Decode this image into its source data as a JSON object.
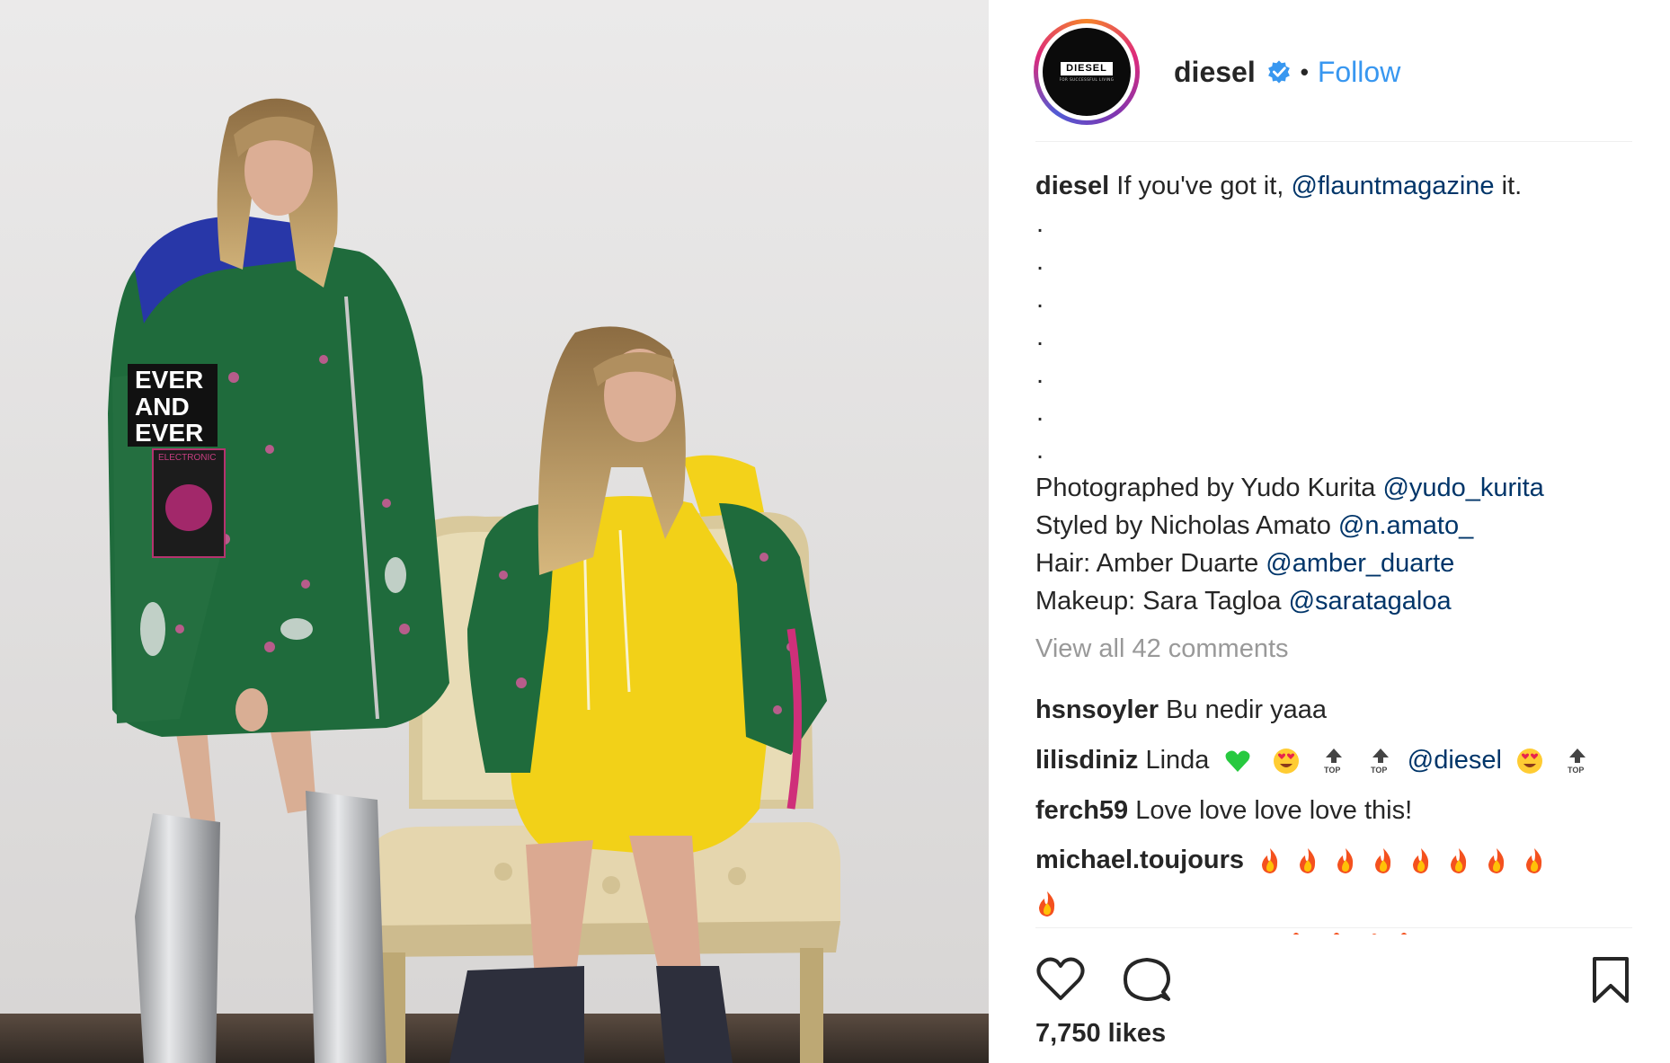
{
  "post": {
    "image_description_icon": "photo-placeholder",
    "account": {
      "username": "diesel",
      "avatar_logo": "DIESEL",
      "avatar_tagline": "FOR SUCCESSFUL LIVING",
      "verified": true,
      "separator": "•",
      "follow_label": "Follow"
    },
    "caption": {
      "author": "diesel",
      "text_before": "If you've got it,",
      "mention": "@flauntmagazine",
      "text_after": "it.",
      "dots": [
        ".",
        ".",
        ".",
        ".",
        ".",
        ".",
        "."
      ],
      "credits": [
        {
          "label": "Photographed by Yudo Kurita",
          "mention": "@yudo_kurita"
        },
        {
          "label": "Styled by Nicholas Amato",
          "mention": "@n.amato_"
        },
        {
          "label": "Hair: Amber Duarte",
          "mention": "@amber_duarte"
        },
        {
          "label": "Makeup: Sara Tagloa",
          "mention": "@saratagaloa"
        }
      ]
    },
    "view_all_comments": "View all 42 comments",
    "comments": [
      {
        "user": "hsnsoyler",
        "text": "Bu nedir yaaa"
      },
      {
        "user": "lilisdiniz",
        "text": "Linda",
        "mention": "@diesel"
      },
      {
        "user": "ferch59",
        "text": "Love love love love this!"
      },
      {
        "user": "michael.toujours",
        "text": ""
      }
    ],
    "emoji_top_label": "TOP",
    "photo_patch": {
      "line1": "EVER",
      "line2": "AND",
      "line3": "EVER",
      "sub": "ELECTRONIC"
    },
    "likes": "7,750 likes",
    "colors": {
      "follow": "#3897f0",
      "mention": "#003569",
      "muted": "#999999",
      "text": "#262626",
      "verified": "#3897f0"
    }
  }
}
